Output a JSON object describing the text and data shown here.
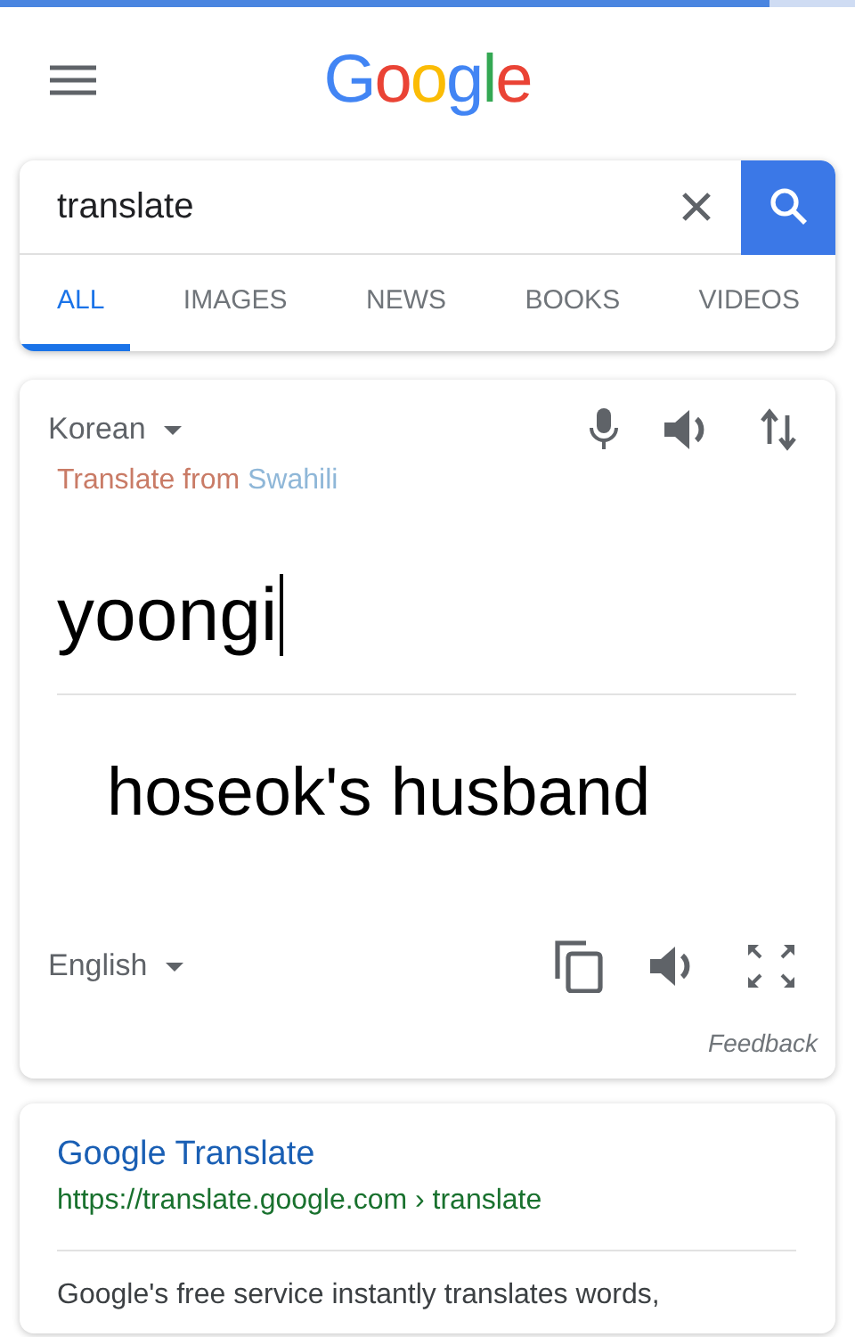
{
  "page_load": {
    "level": 0.9
  },
  "header": {
    "logo": "Google"
  },
  "search": {
    "value": "translate"
  },
  "tabs": [
    {
      "label": "ALL",
      "selected": true
    },
    {
      "label": "IMAGES",
      "selected": false
    },
    {
      "label": "NEWS",
      "selected": false
    },
    {
      "label": "BOOKS",
      "selected": false
    },
    {
      "label": "VIDEOS",
      "selected": false
    }
  ],
  "translator": {
    "source_language": "Korean",
    "suggestion_prefix": "Translate from",
    "suggestion_language": "Swahili",
    "source_text": "yoongi",
    "translation": "hoseok's husband",
    "target_language": "English",
    "feedback": "Feedback"
  },
  "result": {
    "title": "Google Translate",
    "url": "https://translate.google.com › translate",
    "snippet": "Google's free service instantly translates words,"
  }
}
